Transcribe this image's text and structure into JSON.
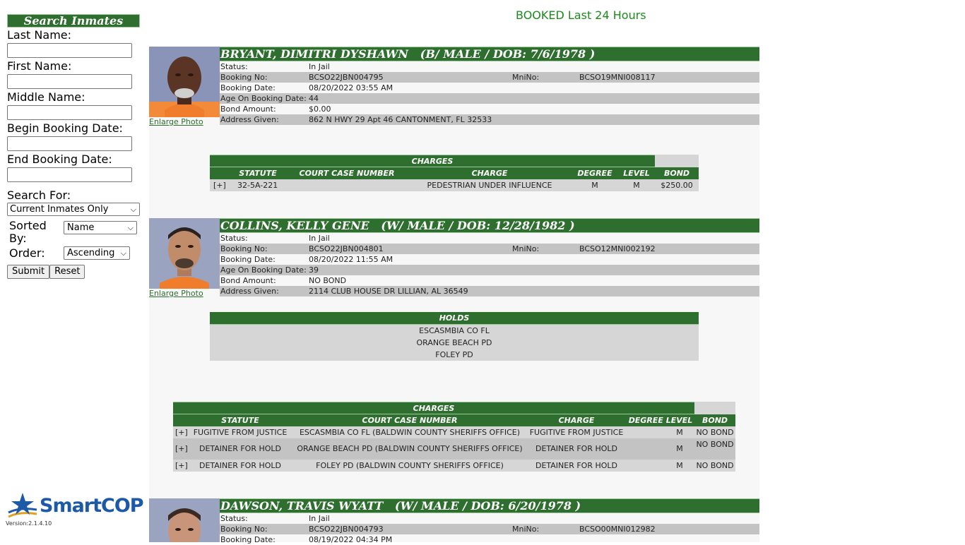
{
  "page": {
    "title": "BOOKED Last 24 Hours"
  },
  "sidebar": {
    "header": "Search Inmates",
    "fields": {
      "last_name": {
        "label": "Last Name:",
        "value": ""
      },
      "first_name": {
        "label": "First Name:",
        "value": ""
      },
      "middle_name": {
        "label": "Middle Name:",
        "value": ""
      },
      "begin_date": {
        "label": "Begin Booking Date:",
        "value": ""
      },
      "end_date": {
        "label": "End Booking Date:",
        "value": ""
      }
    },
    "search_for": {
      "label": "Search For:",
      "value": "Current Inmates Only"
    },
    "sorted_by": {
      "label": "Sorted By:",
      "value": "Name"
    },
    "order": {
      "label": "Order:",
      "value": "Ascending"
    },
    "submit_label": "Submit",
    "reset_label": "Reset",
    "logo_text": "SmartCOP",
    "version": "Version:2.1.4.10"
  },
  "labels": {
    "enlarge": "Enlarge Photo",
    "status": "Status:",
    "booking_no": "Booking No:",
    "mni_no": "MniNo:",
    "booking_date": "Booking Date:",
    "age": "Age On Booking Date:",
    "bond_amount": "Bond Amount:",
    "address": "Address Given:",
    "charges": "CHARGES",
    "holds": "HOLDS",
    "col_statute": "STATUTE",
    "col_case": "COURT CASE NUMBER",
    "col_charge": "CHARGE",
    "col_degree": "DEGREE",
    "col_level": "LEVEL",
    "col_degree_level": "DEGREE LEVEL",
    "col_bond": "BOND"
  },
  "inmates": [
    {
      "name": "BRYANT, DIMITRI DYSHAWN   (B/ MALE / DOB: 7/6/1978 )",
      "status": "In Jail",
      "booking_no": "BCSO22JBN004795",
      "mni_no": "BCSO19MNI008117",
      "booking_date": "08/20/2022 03:55 AM",
      "age": "44",
      "bond_amount": "$0.00",
      "address": "862 N HWY 29 Apt 46 CANTONMENT, FL 32533",
      "charges": [
        {
          "toggle": "[+]",
          "statute": "32-5A-221",
          "case": "",
          "charge": "PEDESTRIAN UNDER INFLUENCE",
          "degree": "M",
          "level": "M",
          "bond": "$250.00"
        }
      ]
    },
    {
      "name": "COLLINS, KELLY GENE   (W/ MALE / DOB: 12/28/1982 )",
      "status": "In Jail",
      "booking_no": "BCSO22JBN004801",
      "mni_no": "BCSO12MNI002192",
      "booking_date": "08/20/2022 11:55 AM",
      "age": "39",
      "bond_amount": "NO BOND",
      "address": "2114 CLUB HOUSE DR LILLIAN, AL 36549",
      "holds": [
        "ESCASMBIA CO FL",
        "ORANGE BEACH PD",
        "FOLEY PD"
      ],
      "charges": [
        {
          "toggle": "[+]",
          "statute": "FUGITIVE FROM JUSTICE",
          "case": "ESCASMBIA CO FL (BALDWIN COUNTY SHERIFFS OFFICE)",
          "charge": "FUGITIVE FROM JUSTICE",
          "degree_level": "M",
          "bond": "NO BOND"
        },
        {
          "toggle": "[+]",
          "statute": "DETAINER FOR HOLD",
          "case": "ORANGE BEACH PD (BALDWIN COUNTY SHERIFFS OFFICE)",
          "charge": "DETAINER FOR HOLD",
          "degree_level": "M",
          "bond": "NO BOND"
        },
        {
          "toggle": "[+]",
          "statute": "DETAINER FOR HOLD",
          "case": "FOLEY PD (BALDWIN COUNTY SHERIFFS OFFICE)",
          "charge": "DETAINER FOR HOLD",
          "degree_level": "M",
          "bond": "NO BOND"
        }
      ]
    },
    {
      "name": "DAWSON, TRAVIS WYATT   (W/ MALE / DOB: 6/20/1978 )",
      "status": "In Jail",
      "booking_no": "BCSO22JBN004793",
      "mni_no": "BCSO00MNI012982",
      "booking_date": "08/19/2022 04:34 PM"
    }
  ],
  "colors": {
    "header_green": "#2e6e2e",
    "title_green": "#1d8a1d",
    "row_gray": "#c3c3c3",
    "table_gray": "#d6d6d6"
  }
}
